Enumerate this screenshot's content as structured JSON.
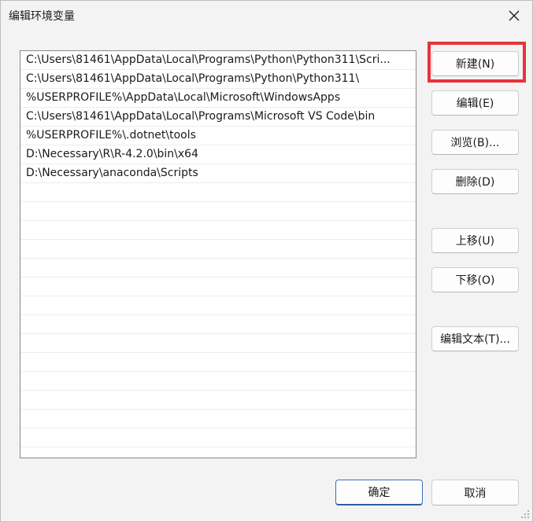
{
  "window": {
    "title": "编辑环境变量"
  },
  "paths": [
    "C:\\Users\\81461\\AppData\\Local\\Programs\\Python\\Python311\\Scri...",
    "C:\\Users\\81461\\AppData\\Local\\Programs\\Python\\Python311\\",
    "%USERPROFILE%\\AppData\\Local\\Microsoft\\WindowsApps",
    "C:\\Users\\81461\\AppData\\Local\\Programs\\Microsoft VS Code\\bin",
    "%USERPROFILE%\\.dotnet\\tools",
    "D:\\Necessary\\R\\R-4.2.0\\bin\\x64",
    "D:\\Necessary\\anaconda\\Scripts"
  ],
  "buttons": {
    "new": "新建(N)",
    "edit": "编辑(E)",
    "browse": "浏览(B)...",
    "delete": "删除(D)",
    "move_up": "上移(U)",
    "move_down": "下移(O)",
    "edit_text": "编辑文本(T)...",
    "ok": "确定",
    "cancel": "取消"
  },
  "colors": {
    "highlight": "#e8333b",
    "accent": "#3b6fb6"
  }
}
